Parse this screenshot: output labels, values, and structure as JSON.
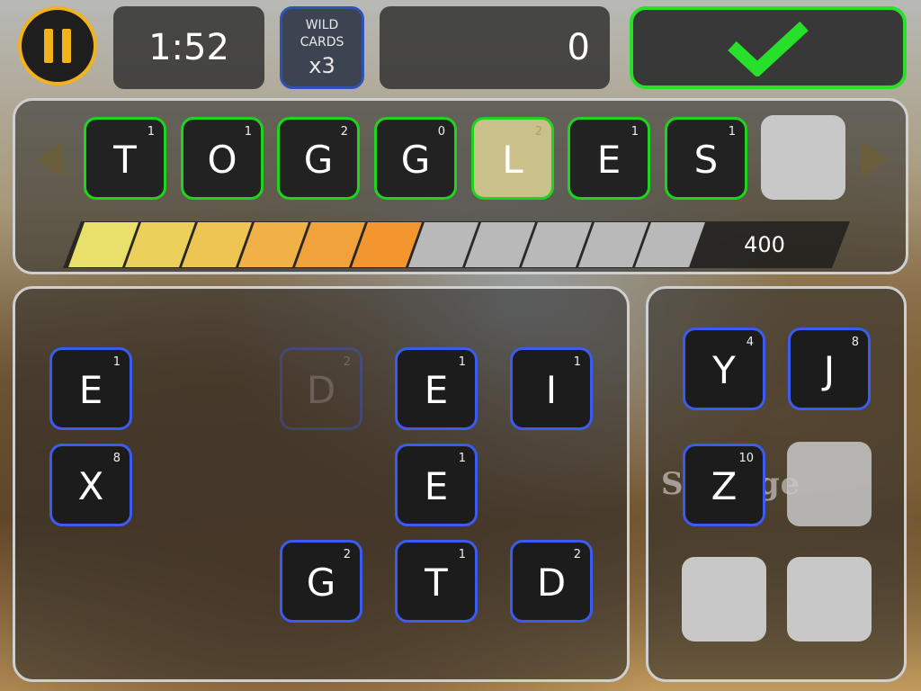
{
  "header": {
    "timer": "1:52",
    "wild_cards_label": "WILD CARDS",
    "wild_cards_count": "x3",
    "score": "0"
  },
  "word": {
    "tiles": [
      {
        "letter": "T",
        "points": "1"
      },
      {
        "letter": "O",
        "points": "1"
      },
      {
        "letter": "G",
        "points": "2"
      },
      {
        "letter": "G",
        "points": "0"
      },
      {
        "letter": "L",
        "points": "2"
      },
      {
        "letter": "E",
        "points": "1"
      },
      {
        "letter": "S",
        "points": "1"
      }
    ],
    "highlighted_index": 4,
    "progress": {
      "segments_total": 11,
      "segments_filled": 6,
      "colors": [
        "#e8e06a",
        "#ecd05c",
        "#eec452",
        "#f0b248",
        "#f2a23c",
        "#f39630"
      ],
      "empty_color": "#b9b9b9",
      "score_label": "400"
    }
  },
  "board": {
    "tiles": [
      {
        "letter": "E",
        "points": "1"
      },
      {
        "letter": "D",
        "points": "2",
        "state": "ghost"
      },
      {
        "letter": "E",
        "points": "1"
      },
      {
        "letter": "I",
        "points": "1"
      },
      {
        "letter": "X",
        "points": "8"
      },
      {
        "letter": "E",
        "points": "1"
      },
      {
        "letter": "G",
        "points": "2"
      },
      {
        "letter": "T",
        "points": "1"
      },
      {
        "letter": "D",
        "points": "2"
      }
    ]
  },
  "storage": {
    "label": "Storage",
    "tiles": [
      {
        "letter": "Y",
        "points": "4"
      },
      {
        "letter": "J",
        "points": "8"
      },
      {
        "letter": "Z",
        "points": "10"
      }
    ]
  },
  "colors": {
    "accent_gold": "#f2b21b",
    "submit_green": "#27e02a",
    "word_border": "#1ed41e",
    "tile_border_blue": "#3a5cf0"
  },
  "icons": [
    "pause-icon",
    "checkmark-icon",
    "arrow-left-icon",
    "arrow-right-icon"
  ]
}
